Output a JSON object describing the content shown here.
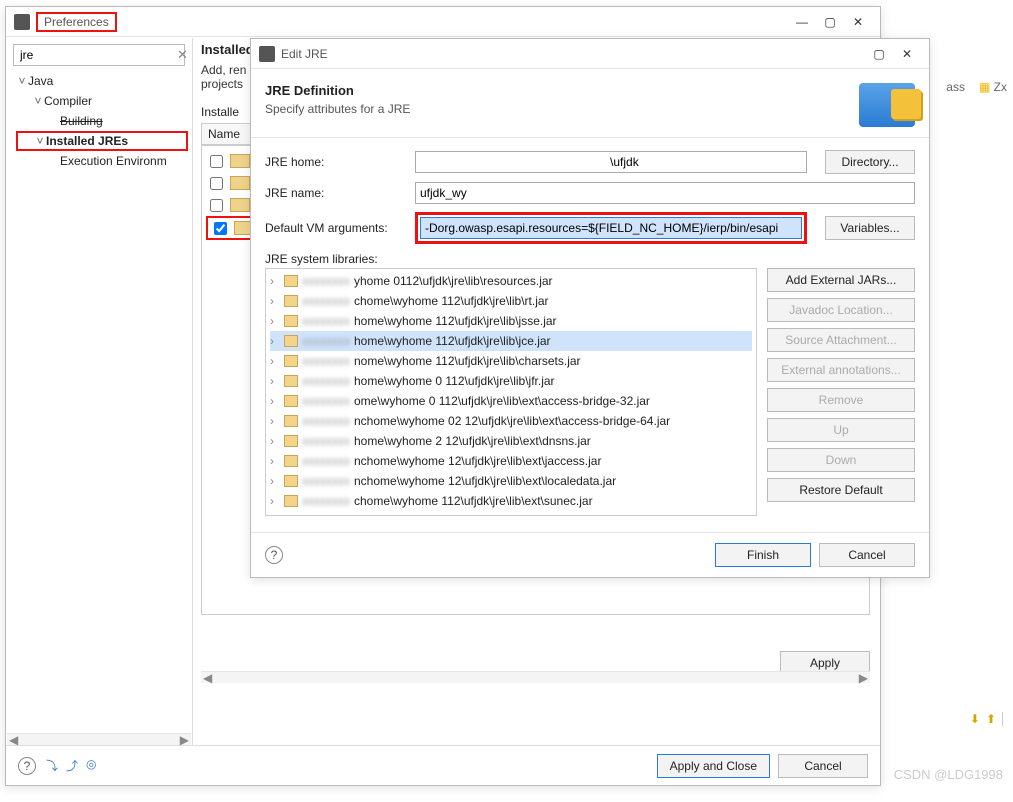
{
  "prefs": {
    "title": "Preferences",
    "search_value": "jre",
    "tree": {
      "java": "Java",
      "compiler": "Compiler",
      "building": "Building",
      "installed_jres": "Installed JREs",
      "exec_env": "Execution Environm"
    },
    "right": {
      "heading": "Installed",
      "desc1": "Add, ren",
      "desc2": "projects",
      "col_name": "Installe",
      "col_head": "Name"
    },
    "footer": {
      "apply": "Apply",
      "apply_close": "Apply and Close",
      "cancel": "Cancel"
    }
  },
  "editjre": {
    "title": "Edit JRE",
    "def_title": "JRE Definition",
    "def_sub": "Specify attributes for a JRE",
    "labels": {
      "home": "JRE home:",
      "name": "JRE name:",
      "vmargs": "Default VM arguments:",
      "syslib": "JRE system libraries:"
    },
    "values": {
      "home": "                                                         \\ufjdk",
      "name": "ufjdk_wy",
      "vmargs": "-Dorg.owasp.esapi.resources=${FIELD_NC_HOME}/ierp/bin/esapi"
    },
    "buttons": {
      "directory": "Directory...",
      "variables": "Variables...",
      "add_ext": "Add External JARs...",
      "javadoc": "Javadoc Location...",
      "srcattach": "Source Attachment...",
      "extann": "External annotations...",
      "remove": "Remove",
      "up": "Up",
      "down": "Down",
      "restore": "Restore Default",
      "finish": "Finish",
      "cancel": "Cancel"
    },
    "libs": [
      "yhome        0112\\ufjdk\\jre\\lib\\resources.jar",
      "chome\\wyhome        112\\ufjdk\\jre\\lib\\rt.jar",
      "home\\wyhome        112\\ufjdk\\jre\\lib\\jsse.jar",
      "home\\wyhome        112\\ufjdk\\jre\\lib\\jce.jar",
      "nome\\wyhome        112\\ufjdk\\jre\\lib\\charsets.jar",
      "home\\wyhome    0   112\\ufjdk\\jre\\lib\\jfr.jar",
      "ome\\wyhome    0    112\\ufjdk\\jre\\lib\\ext\\access-bridge-32.jar",
      "nchome\\wyhome    02    12\\ufjdk\\jre\\lib\\ext\\access-bridge-64.jar",
      "home\\wyhome    2    12\\ufjdk\\jre\\lib\\ext\\dnsns.jar",
      "nchome\\wyhome        12\\ufjdk\\jre\\lib\\ext\\jaccess.jar",
      "nchome\\wyhome        12\\ufjdk\\jre\\lib\\ext\\localedata.jar",
      "chome\\wyhome        112\\ufjdk\\jre\\lib\\ext\\sunec.jar"
    ],
    "lib_selected_index": 3
  },
  "watermark": "CSDN @LDG1998",
  "extra_right": {
    "ass": "ass",
    "zx": "Zx"
  }
}
